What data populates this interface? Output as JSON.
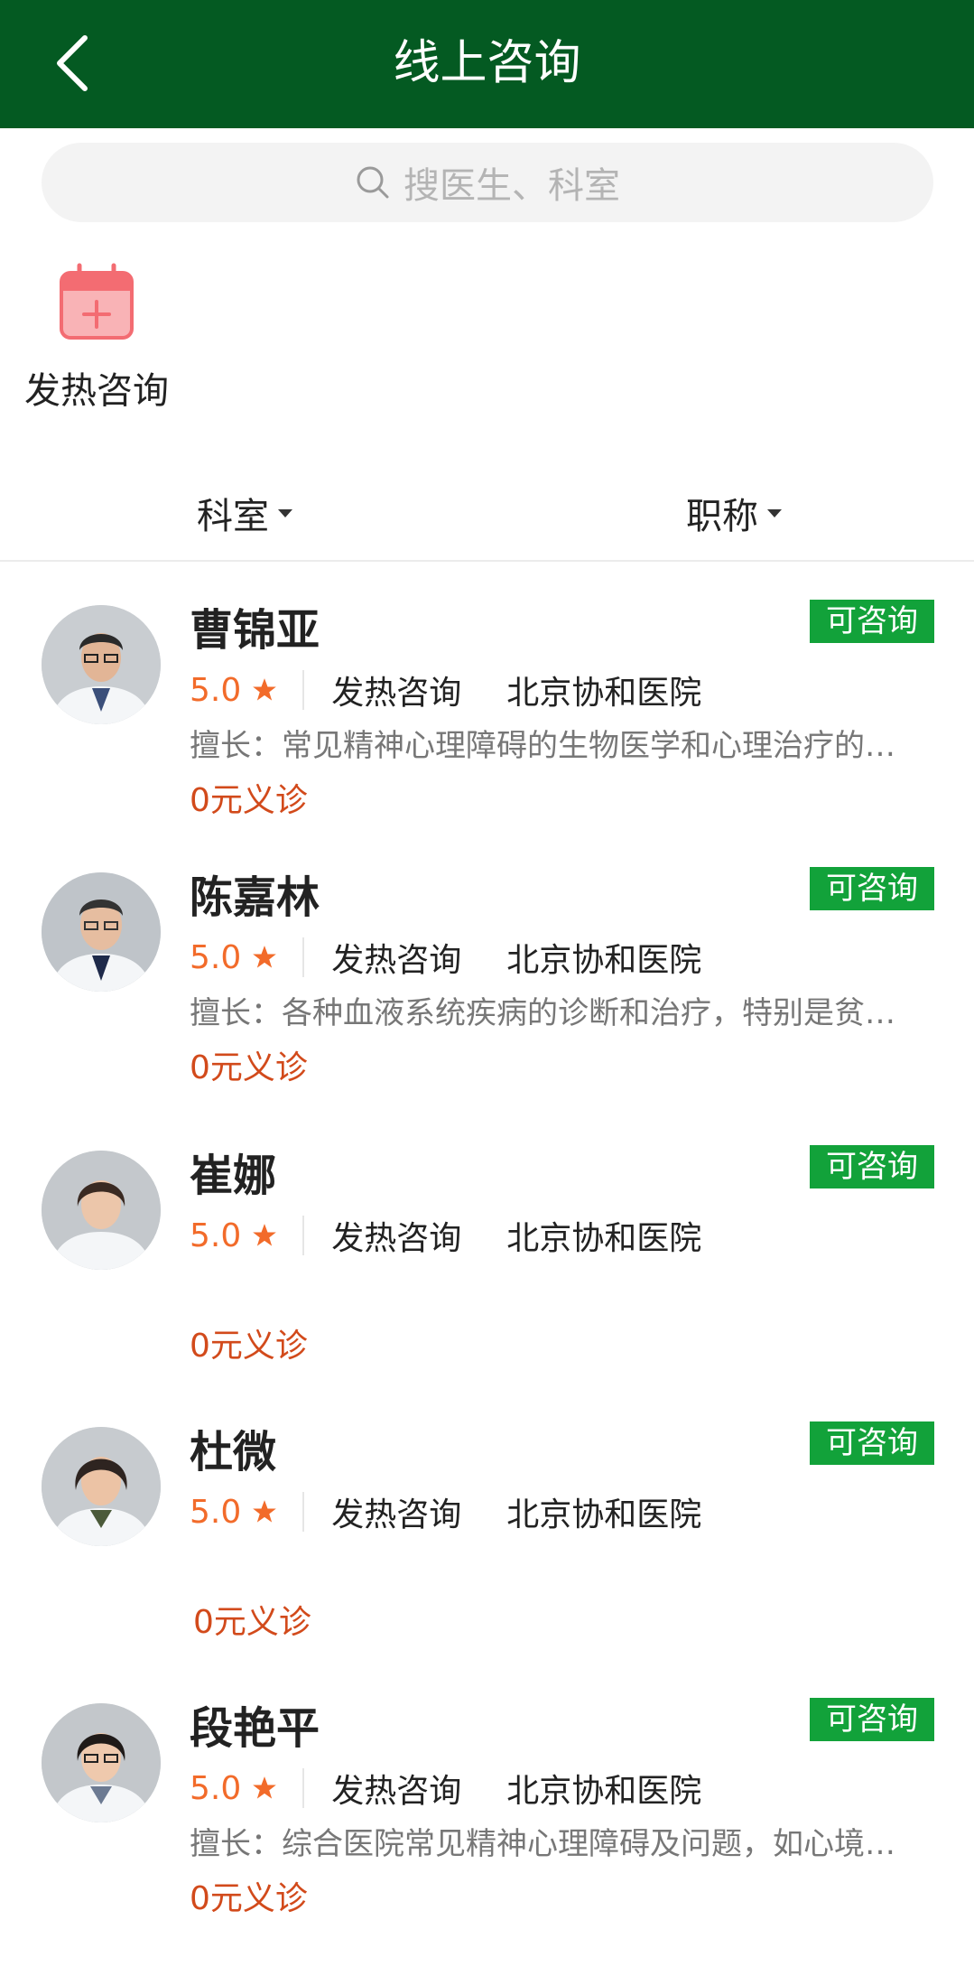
{
  "header": {
    "title": "线上咨询",
    "back_icon": "chevron-left-icon"
  },
  "search": {
    "placeholder": "搜医生、科室",
    "icon": "search-icon"
  },
  "quick_entries": [
    {
      "label": "发热咨询",
      "icon": "calendar-plus-icon",
      "color": "#f36c72"
    }
  ],
  "filters": [
    {
      "label": "科室"
    },
    {
      "label": "职称"
    }
  ],
  "colors": {
    "header_bg": "#045a22",
    "badge_bg": "#12a23a",
    "rating": "#f26b2a",
    "price": "#d24a1b"
  },
  "doctors": [
    {
      "name": "曹锦亚",
      "status": "可咨询",
      "rating": "5.0",
      "department": "发热咨询",
      "hospital": "北京协和医院",
      "specialty": "擅长：常见精神心理障碍的生物医学和心理治疗的…",
      "price": "0元义诊"
    },
    {
      "name": "陈嘉林",
      "status": "可咨询",
      "rating": "5.0",
      "department": "发热咨询",
      "hospital": "北京协和医院",
      "specialty": "擅长：各种血液系统疾病的诊断和治疗，特别是贫…",
      "price": "0元义诊"
    },
    {
      "name": "崔娜",
      "status": "可咨询",
      "rating": "5.0",
      "department": "发热咨询",
      "hospital": "北京协和医院",
      "specialty": "",
      "price": "0元义诊"
    },
    {
      "name": "杜微",
      "status": "可咨询",
      "rating": "5.0",
      "department": "发热咨询",
      "hospital": "北京协和医院",
      "specialty": "",
      "price": "0元义诊"
    },
    {
      "name": "段艳平",
      "status": "可咨询",
      "rating": "5.0",
      "department": "发热咨询",
      "hospital": "北京协和医院",
      "specialty": "擅长：综合医院常见精神心理障碍及问题，如心境…",
      "price": "0元义诊"
    }
  ]
}
